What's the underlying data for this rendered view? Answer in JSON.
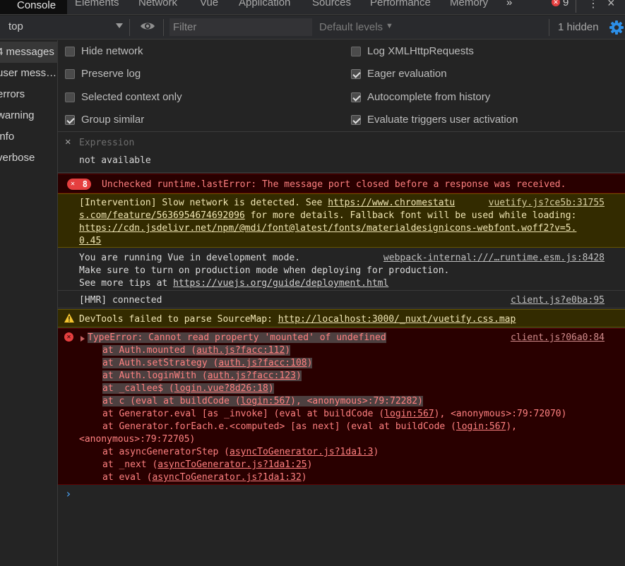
{
  "tabs": [
    {
      "label": "Console",
      "active": true
    },
    {
      "label": "Elements"
    },
    {
      "label": "Network"
    },
    {
      "label": "Vue"
    },
    {
      "label": "Application"
    },
    {
      "label": "Sources"
    },
    {
      "label": "Performance"
    },
    {
      "label": "Memory"
    }
  ],
  "tab_more": "»",
  "error_count": "9",
  "toolbar": {
    "context": "top",
    "filter_placeholder": "Filter",
    "levels": "Default levels",
    "hidden": "1 hidden"
  },
  "sidebar": {
    "items": [
      {
        "label": "4 messages",
        "selected": true
      },
      {
        "label": "user mess…"
      },
      {
        "label": "errors"
      },
      {
        "label": "warning"
      },
      {
        "label": "info"
      },
      {
        "label": "verbose"
      }
    ]
  },
  "settings": {
    "left": [
      {
        "label": "Hide network",
        "checked": false
      },
      {
        "label": "Preserve log",
        "checked": false
      },
      {
        "label": "Selected context only",
        "checked": false
      },
      {
        "label": "Group similar",
        "checked": true
      }
    ],
    "right": [
      {
        "label": "Log XMLHttpRequests",
        "checked": false
      },
      {
        "label": "Eager evaluation",
        "checked": true
      },
      {
        "label": "Autocomplete from history",
        "checked": true
      },
      {
        "label": "Evaluate triggers user activation",
        "checked": true
      }
    ]
  },
  "expression": {
    "label": "Expression",
    "value": "not available"
  },
  "messages": {
    "err1": {
      "count": "8",
      "text": "Unchecked runtime.lastError: The message port closed before a response was received."
    },
    "warn1": {
      "source": "vuetify.js?ce5b:31755",
      "l1_prefix": "[Intervention] Slow network is detected. See ",
      "l1_link": "https://www.chromestatu",
      "l2_link": "s.com/feature/5636954674692096",
      "l2_suffix": " for more details. Fallback font will be used while loading:",
      "l3_link": "https://cdn.jsdelivr.net/npm/@mdi/font@latest/fonts/materialdesignicons-webfont.woff2?v=5.",
      "l4_link": "0.45"
    },
    "vue": {
      "source": "webpack-internal:///…runtime.esm.js:8428",
      "l1": "You are running Vue in development mode.",
      "l2": "Make sure to turn on production mode when deploying for production.",
      "l3_prefix": "See more tips at ",
      "l3_link": "https://vuejs.org/guide/deployment.html"
    },
    "hmr": {
      "text": "[HMR] connected",
      "source": "client.js?e0ba:95"
    },
    "warn2": {
      "prefix": "DevTools failed to parse SourceMap: ",
      "link": "http://localhost:3000/_nuxt/vuetify.css.map"
    },
    "err2": {
      "source": "client.js?06a0:84",
      "title": "TypeError: Cannot read property 'mounted' of undefined",
      "stack": [
        {
          "pre": "at Auth.mounted (",
          "link": "auth.js?facc:112",
          "post": ")"
        },
        {
          "pre": "at Auth.setStrategy (",
          "link": "auth.js?facc:108",
          "post": ")"
        },
        {
          "pre": "at Auth.loginWith (",
          "link": "auth.js?facc:123",
          "post": ")"
        },
        {
          "pre": "at _callee$ (",
          "link": "login.vue?8d26:18",
          "post": ")"
        },
        {
          "pre": "at c (eval at buildCode (",
          "link": "login:567",
          "post": "), <anonymous>:79:72282)"
        },
        {
          "pre": "at Generator.eval [as _invoke] (eval at buildCode (",
          "link": "login:567",
          "post": "), <anonymous>:79:72070)"
        },
        {
          "pre": "at Generator.forEach.e.<computed> [as next] (eval at buildCode (",
          "link": "login:567",
          "post": "),"
        },
        {
          "pre": "<anonymous>:79:72705)",
          "link": "",
          "post": ""
        },
        {
          "pre": "at asyncGeneratorStep (",
          "link": "asyncToGenerator.js?1da1:3",
          "post": ")"
        },
        {
          "pre": "at _next (",
          "link": "asyncToGenerator.js?1da1:25",
          "post": ")"
        },
        {
          "pre": "at eval (",
          "link": "asyncToGenerator.js?1da1:32",
          "post": ")"
        }
      ]
    }
  },
  "colors": {
    "error_bg": "#290000",
    "warning_bg": "#332b00",
    "error_text": "#ff8080",
    "warning_text": "#f0e6b4",
    "prompt": "#4aa2f3"
  }
}
